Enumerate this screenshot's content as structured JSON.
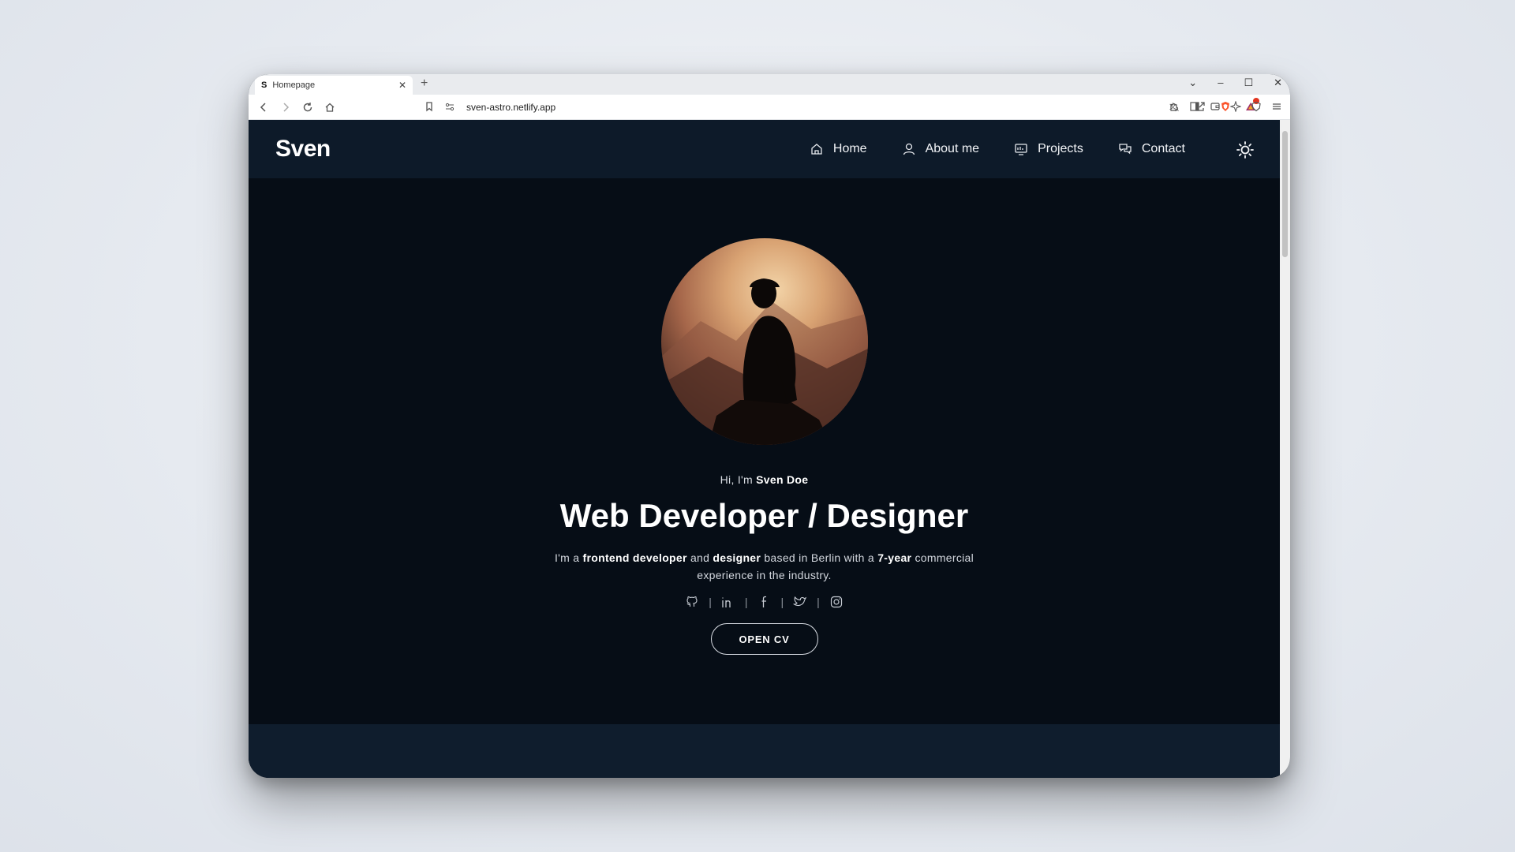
{
  "browser": {
    "tab_title": "Homepage",
    "tab_favicon": "S",
    "url": "sven-astro.netlify.app",
    "icons": [
      "back-icon",
      "forward-icon",
      "reload-icon",
      "home-icon",
      "bookmark-icon",
      "site-settings-icon",
      "translate-icon",
      "share-icon",
      "brave-shield-icon",
      "brave-rewards-icon",
      "extensions-icon",
      "sidebar-icon",
      "wallet-icon",
      "leo-ai-icon",
      "vpn-icon",
      "menu-icon"
    ]
  },
  "site": {
    "logo": "Sven",
    "nav": [
      {
        "label": "Home",
        "icon": "home-icon"
      },
      {
        "label": "About me",
        "icon": "user-icon"
      },
      {
        "label": "Projects",
        "icon": "presentation-icon"
      },
      {
        "label": "Contact",
        "icon": "chat-icon"
      }
    ]
  },
  "hero": {
    "greeting_prefix": "Hi, I'm ",
    "name": "Sven Doe",
    "headline": "Web Developer / Designer",
    "desc": {
      "p1": "I'm a ",
      "b1": "frontend developer",
      "p2": " and ",
      "b2": "designer",
      "p3": " based in Berlin with a ",
      "b3": "7-year",
      "p4": " commercial experience in the industry."
    },
    "socials": [
      "github-icon",
      "linkedin-icon",
      "facebook-icon",
      "twitter-icon",
      "instagram-icon"
    ],
    "cv_label": "OPEN CV"
  },
  "colors": {
    "page_bg": "#060d16",
    "header_bg": "#0d1a29",
    "footer_bg": "#0f1d2d"
  }
}
